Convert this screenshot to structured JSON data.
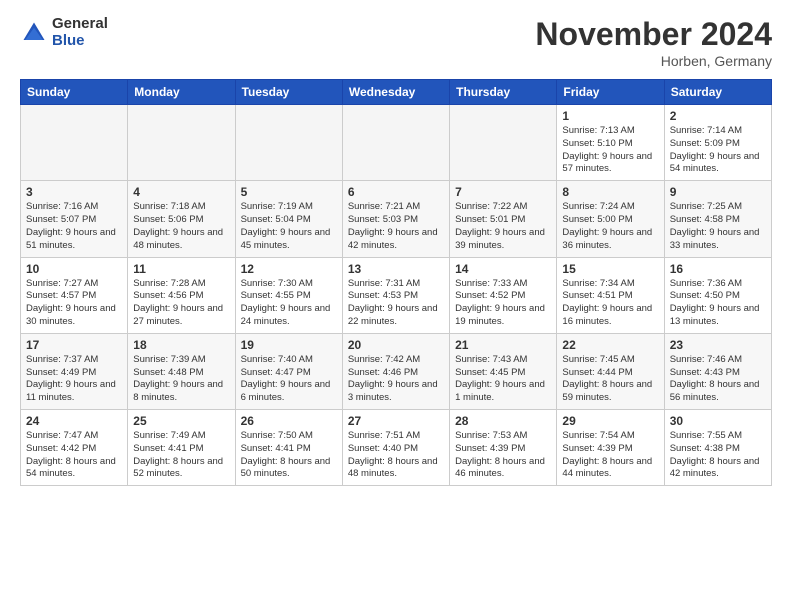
{
  "logo": {
    "general": "General",
    "blue": "Blue"
  },
  "header": {
    "title": "November 2024",
    "location": "Horben, Germany"
  },
  "days_of_week": [
    "Sunday",
    "Monday",
    "Tuesday",
    "Wednesday",
    "Thursday",
    "Friday",
    "Saturday"
  ],
  "weeks": [
    [
      {
        "day": "",
        "empty": true
      },
      {
        "day": "",
        "empty": true
      },
      {
        "day": "",
        "empty": true
      },
      {
        "day": "",
        "empty": true
      },
      {
        "day": "",
        "empty": true
      },
      {
        "day": "1",
        "sunrise": "Sunrise: 7:13 AM",
        "sunset": "Sunset: 5:10 PM",
        "daylight": "Daylight: 9 hours and 57 minutes."
      },
      {
        "day": "2",
        "sunrise": "Sunrise: 7:14 AM",
        "sunset": "Sunset: 5:09 PM",
        "daylight": "Daylight: 9 hours and 54 minutes."
      }
    ],
    [
      {
        "day": "3",
        "sunrise": "Sunrise: 7:16 AM",
        "sunset": "Sunset: 5:07 PM",
        "daylight": "Daylight: 9 hours and 51 minutes."
      },
      {
        "day": "4",
        "sunrise": "Sunrise: 7:18 AM",
        "sunset": "Sunset: 5:06 PM",
        "daylight": "Daylight: 9 hours and 48 minutes."
      },
      {
        "day": "5",
        "sunrise": "Sunrise: 7:19 AM",
        "sunset": "Sunset: 5:04 PM",
        "daylight": "Daylight: 9 hours and 45 minutes."
      },
      {
        "day": "6",
        "sunrise": "Sunrise: 7:21 AM",
        "sunset": "Sunset: 5:03 PM",
        "daylight": "Daylight: 9 hours and 42 minutes."
      },
      {
        "day": "7",
        "sunrise": "Sunrise: 7:22 AM",
        "sunset": "Sunset: 5:01 PM",
        "daylight": "Daylight: 9 hours and 39 minutes."
      },
      {
        "day": "8",
        "sunrise": "Sunrise: 7:24 AM",
        "sunset": "Sunset: 5:00 PM",
        "daylight": "Daylight: 9 hours and 36 minutes."
      },
      {
        "day": "9",
        "sunrise": "Sunrise: 7:25 AM",
        "sunset": "Sunset: 4:58 PM",
        "daylight": "Daylight: 9 hours and 33 minutes."
      }
    ],
    [
      {
        "day": "10",
        "sunrise": "Sunrise: 7:27 AM",
        "sunset": "Sunset: 4:57 PM",
        "daylight": "Daylight: 9 hours and 30 minutes."
      },
      {
        "day": "11",
        "sunrise": "Sunrise: 7:28 AM",
        "sunset": "Sunset: 4:56 PM",
        "daylight": "Daylight: 9 hours and 27 minutes."
      },
      {
        "day": "12",
        "sunrise": "Sunrise: 7:30 AM",
        "sunset": "Sunset: 4:55 PM",
        "daylight": "Daylight: 9 hours and 24 minutes."
      },
      {
        "day": "13",
        "sunrise": "Sunrise: 7:31 AM",
        "sunset": "Sunset: 4:53 PM",
        "daylight": "Daylight: 9 hours and 22 minutes."
      },
      {
        "day": "14",
        "sunrise": "Sunrise: 7:33 AM",
        "sunset": "Sunset: 4:52 PM",
        "daylight": "Daylight: 9 hours and 19 minutes."
      },
      {
        "day": "15",
        "sunrise": "Sunrise: 7:34 AM",
        "sunset": "Sunset: 4:51 PM",
        "daylight": "Daylight: 9 hours and 16 minutes."
      },
      {
        "day": "16",
        "sunrise": "Sunrise: 7:36 AM",
        "sunset": "Sunset: 4:50 PM",
        "daylight": "Daylight: 9 hours and 13 minutes."
      }
    ],
    [
      {
        "day": "17",
        "sunrise": "Sunrise: 7:37 AM",
        "sunset": "Sunset: 4:49 PM",
        "daylight": "Daylight: 9 hours and 11 minutes."
      },
      {
        "day": "18",
        "sunrise": "Sunrise: 7:39 AM",
        "sunset": "Sunset: 4:48 PM",
        "daylight": "Daylight: 9 hours and 8 minutes."
      },
      {
        "day": "19",
        "sunrise": "Sunrise: 7:40 AM",
        "sunset": "Sunset: 4:47 PM",
        "daylight": "Daylight: 9 hours and 6 minutes."
      },
      {
        "day": "20",
        "sunrise": "Sunrise: 7:42 AM",
        "sunset": "Sunset: 4:46 PM",
        "daylight": "Daylight: 9 hours and 3 minutes."
      },
      {
        "day": "21",
        "sunrise": "Sunrise: 7:43 AM",
        "sunset": "Sunset: 4:45 PM",
        "daylight": "Daylight: 9 hours and 1 minute."
      },
      {
        "day": "22",
        "sunrise": "Sunrise: 7:45 AM",
        "sunset": "Sunset: 4:44 PM",
        "daylight": "Daylight: 8 hours and 59 minutes."
      },
      {
        "day": "23",
        "sunrise": "Sunrise: 7:46 AM",
        "sunset": "Sunset: 4:43 PM",
        "daylight": "Daylight: 8 hours and 56 minutes."
      }
    ],
    [
      {
        "day": "24",
        "sunrise": "Sunrise: 7:47 AM",
        "sunset": "Sunset: 4:42 PM",
        "daylight": "Daylight: 8 hours and 54 minutes."
      },
      {
        "day": "25",
        "sunrise": "Sunrise: 7:49 AM",
        "sunset": "Sunset: 4:41 PM",
        "daylight": "Daylight: 8 hours and 52 minutes."
      },
      {
        "day": "26",
        "sunrise": "Sunrise: 7:50 AM",
        "sunset": "Sunset: 4:41 PM",
        "daylight": "Daylight: 8 hours and 50 minutes."
      },
      {
        "day": "27",
        "sunrise": "Sunrise: 7:51 AM",
        "sunset": "Sunset: 4:40 PM",
        "daylight": "Daylight: 8 hours and 48 minutes."
      },
      {
        "day": "28",
        "sunrise": "Sunrise: 7:53 AM",
        "sunset": "Sunset: 4:39 PM",
        "daylight": "Daylight: 8 hours and 46 minutes."
      },
      {
        "day": "29",
        "sunrise": "Sunrise: 7:54 AM",
        "sunset": "Sunset: 4:39 PM",
        "daylight": "Daylight: 8 hours and 44 minutes."
      },
      {
        "day": "30",
        "sunrise": "Sunrise: 7:55 AM",
        "sunset": "Sunset: 4:38 PM",
        "daylight": "Daylight: 8 hours and 42 minutes."
      }
    ]
  ]
}
